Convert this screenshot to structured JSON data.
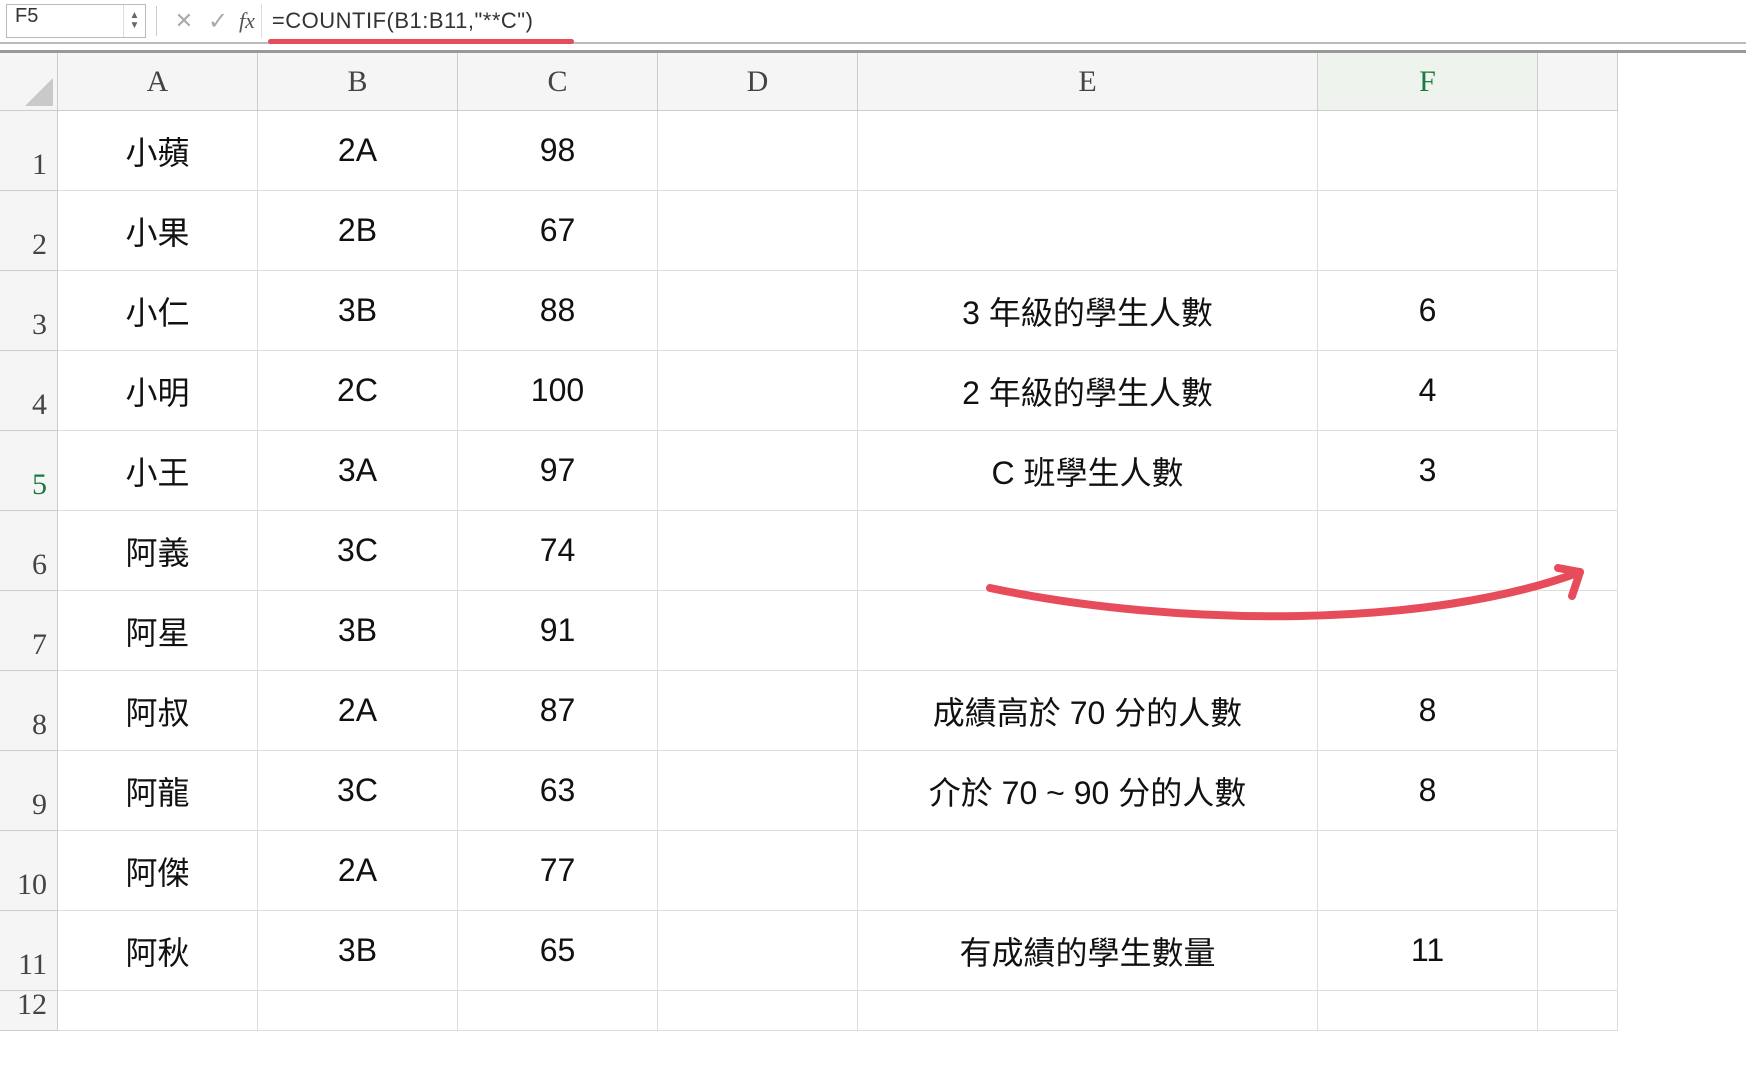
{
  "namebox": {
    "value": "F5"
  },
  "formula_bar": {
    "fx_label": "fx",
    "formula": "=COUNTIF(B1:B11,\"**C\")"
  },
  "columns": [
    "A",
    "B",
    "C",
    "D",
    "E",
    "F"
  ],
  "row_numbers": [
    "1",
    "2",
    "3",
    "4",
    "5",
    "6",
    "7",
    "8",
    "9",
    "10",
    "11",
    "12"
  ],
  "selected_row": 5,
  "selected_col": "F",
  "grid": {
    "A": [
      "小蘋",
      "小果",
      "小仁",
      "小明",
      "小王",
      "阿義",
      "阿星",
      "阿叔",
      "阿龍",
      "阿傑",
      "阿秋",
      ""
    ],
    "B": [
      "2A",
      "2B",
      "3B",
      "2C",
      "3A",
      "3C",
      "3B",
      "2A",
      "3C",
      "2A",
      "3B",
      ""
    ],
    "C": [
      "98",
      "67",
      "88",
      "100",
      "97",
      "74",
      "91",
      "87",
      "63",
      "77",
      "65",
      ""
    ],
    "D": [
      "",
      "",
      "",
      "",
      "",
      "",
      "",
      "",
      "",
      "",
      "",
      ""
    ],
    "E": [
      "",
      "",
      "3 年級的學生人數",
      "2 年級的學生人數",
      "C 班學生人數",
      "",
      "",
      "成績高於 70 分的人數",
      "介於 70 ~ 90 分的人數",
      "",
      "有成績的學生數量",
      ""
    ],
    "F": [
      "",
      "",
      "6",
      "4",
      "3",
      "",
      "",
      "8",
      "8",
      "",
      "11",
      ""
    ]
  },
  "icons": {
    "up": "▲",
    "down": "▼",
    "cancel": "✕",
    "accept": "✓"
  }
}
